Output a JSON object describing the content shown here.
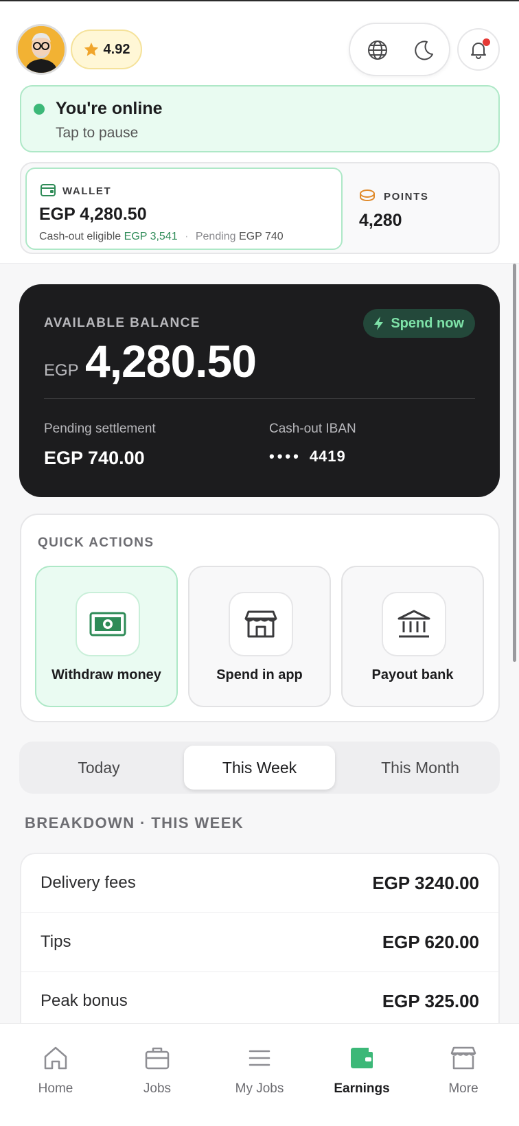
{
  "header": {
    "rating": "4.92",
    "colors": {
      "accent_green": "#3cb878",
      "dark_card": "#1c1c1e",
      "notification_dot": "#e53935"
    }
  },
  "status": {
    "title": "You're online",
    "subtitle": "Tap to pause"
  },
  "wallet": {
    "label": "WALLET",
    "amount": "EGP 4,280.50",
    "eligible_label": "Cash-out eligible",
    "eligible_value": "EGP 3,541",
    "pending_label": "Pending",
    "pending_value": "EGP 740"
  },
  "points": {
    "label": "POINTS",
    "value": "4,280"
  },
  "balance": {
    "caption": "AVAILABLE BALANCE",
    "spend_label": "Spend now",
    "currency": "EGP",
    "amount": "4,280.50",
    "pending_label": "Pending settlement",
    "pending_value": "EGP 740.00",
    "iban_label": "Cash-out IBAN",
    "iban_mask": "••••",
    "iban_last4": "4419"
  },
  "quick_actions": {
    "caption": "QUICK ACTIONS",
    "items": [
      {
        "label": "Withdraw money",
        "icon": "cash-icon"
      },
      {
        "label": "Spend in app",
        "icon": "store-icon"
      },
      {
        "label": "Payout bank",
        "icon": "bank-icon"
      }
    ]
  },
  "periods": {
    "items": [
      "Today",
      "This Week",
      "This Month"
    ],
    "selected": "This Week"
  },
  "breakdown": {
    "caption": "BREAKDOWN · THIS WEEK",
    "rows": [
      {
        "label": "Delivery fees",
        "value": "EGP 3240.00"
      },
      {
        "label": "Tips",
        "value": "EGP 620.00"
      },
      {
        "label": "Peak bonus",
        "value": "EGP 325.00"
      }
    ]
  },
  "nav": {
    "items": [
      {
        "label": "Home",
        "icon": "home-icon"
      },
      {
        "label": "Jobs",
        "icon": "briefcase-icon"
      },
      {
        "label": "My Jobs",
        "icon": "list-icon"
      },
      {
        "label": "Earnings",
        "icon": "wallet-icon"
      },
      {
        "label": "More",
        "icon": "store-icon"
      }
    ],
    "active": "Earnings"
  }
}
